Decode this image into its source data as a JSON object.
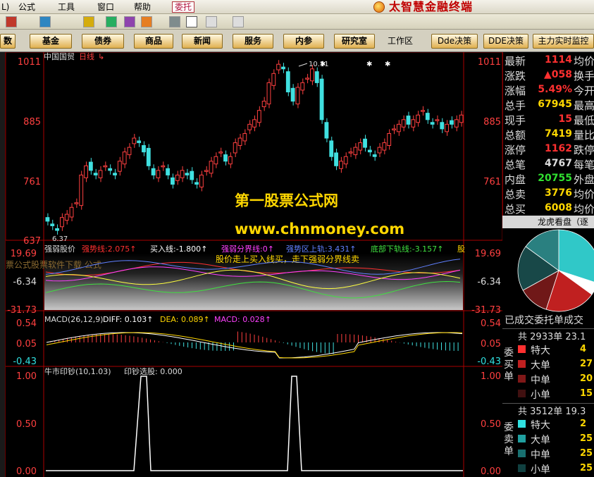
{
  "menubar": {
    "items": [
      "L)",
      "公式",
      "工具",
      "窗口",
      "帮助",
      "委托"
    ],
    "active": "委托",
    "app_title": "太智慧金融终端"
  },
  "navrow": {
    "buttons": [
      "数",
      "基金",
      "债券",
      "商品",
      "新闻",
      "服务",
      "内参",
      "研究室"
    ],
    "workspace_label": "工作区",
    "right_buttons": [
      "Dde决策",
      "DDE决策",
      "主力实时监控"
    ]
  },
  "price_panel": {
    "stock_name": "中国国贸",
    "period": "日线",
    "y_ticks": [
      "1011",
      "885",
      "761",
      "637"
    ],
    "high_label": "10.11",
    "low_label": "6.37"
  },
  "strength_panel": {
    "title": "强弱股价",
    "indicators": [
      {
        "name": "强势线:",
        "value": "2.075"
      },
      {
        "name": "买入线:",
        "value": "-1.800"
      },
      {
        "name": "强弱分界线:",
        "value": "0"
      },
      {
        "name": "强势区上轨:",
        "value": "3.431"
      },
      {
        "name": "底部下轨线:",
        "value": "-3.157"
      }
    ],
    "tail_text": "股",
    "subtitle": "股价走上买入线买，走下强弱分界线卖",
    "y_ticks": [
      "19.69",
      "-6.34",
      "-31.73"
    ],
    "left_watermark": "票公式股票软件下载 公式"
  },
  "macd_panel": {
    "title": "MACD(26,12,9)",
    "diff_label": "DIFF:",
    "diff_value": "0.103",
    "dea_label": "DEA:",
    "dea_value": "0.089",
    "macd_label": "MACD:",
    "macd_value": "0.028",
    "y_ticks": [
      "0.54",
      "0.05",
      "-0.43"
    ]
  },
  "niushi_panel": {
    "title": "牛市印钞(10,1.03)",
    "label": "印钞选股:",
    "value": "0.000",
    "y_ticks": [
      "1.00",
      "0.50",
      "0.00"
    ]
  },
  "watermark": {
    "line1": "第一股票公式网",
    "line2": "www.chnmoney.com"
  },
  "quote": {
    "rows": [
      {
        "label": "最新",
        "value": "1114",
        "color": "#ff3030",
        "label2": "均价"
      },
      {
        "label": "涨跌",
        "value": "▲058",
        "color": "#ff3030",
        "label2": "换手"
      },
      {
        "label": "涨幅",
        "value": "5.49%",
        "color": "#ff3030",
        "label2": "今开"
      },
      {
        "label": "总手",
        "value": "67945",
        "color": "#ffd700",
        "label2": "最高"
      },
      {
        "label": "现手",
        "value": "15",
        "color": "#ff3030",
        "label2": "最低"
      },
      {
        "label": "总额",
        "value": "7419",
        "color": "#ffd700",
        "label2": "量比"
      },
      {
        "label": "涨停",
        "value": "1162",
        "color": "#ff3030",
        "label2": "跌停"
      },
      {
        "label": "总笔",
        "value": "4767",
        "color": "#dddddd",
        "label2": "每笔"
      },
      {
        "label": "内盘",
        "value": "20755",
        "color": "#30e030",
        "label2": "外盘"
      },
      {
        "label": "总卖",
        "value": "3776",
        "color": "#ffd700",
        "label2": "均价"
      },
      {
        "label": "总买",
        "value": "6008",
        "color": "#ffd700",
        "label2": "均价"
      }
    ]
  },
  "longhu": {
    "header": "龙虎看盘（逐",
    "caption": "已成交委托单成交",
    "slices": [
      {
        "value": 30,
        "color": "#30c8c8"
      },
      {
        "value": 5,
        "color": "#ffffff"
      },
      {
        "value": 20,
        "color": "#c02020"
      },
      {
        "value": 12,
        "color": "#701818"
      },
      {
        "value": 18,
        "color": "#184848"
      },
      {
        "value": 15,
        "color": "#2a8080"
      }
    ]
  },
  "buy_orders": {
    "total_prefix": "共",
    "total": "2933单",
    "total_tail": "23.1",
    "side_label": "委买单",
    "rows": [
      {
        "label": "特大",
        "value": "4",
        "color": "#ff3030"
      },
      {
        "label": "大单",
        "value": "27",
        "color": "#c02020"
      },
      {
        "label": "中单",
        "value": "20",
        "color": "#801818"
      },
      {
        "label": "小单",
        "value": "15",
        "color": "#401010"
      }
    ]
  },
  "sell_orders": {
    "total_prefix": "共",
    "total": "3512单",
    "total_tail": "19.3",
    "side_label": "委卖单",
    "rows": [
      {
        "label": "特大",
        "value": "2",
        "color": "#30e0e0"
      },
      {
        "label": "大单",
        "value": "25",
        "color": "#20a0a0"
      },
      {
        "label": "中单",
        "value": "25",
        "color": "#187070"
      },
      {
        "label": "小单",
        "value": "25",
        "color": "#104040"
      }
    ]
  }
}
